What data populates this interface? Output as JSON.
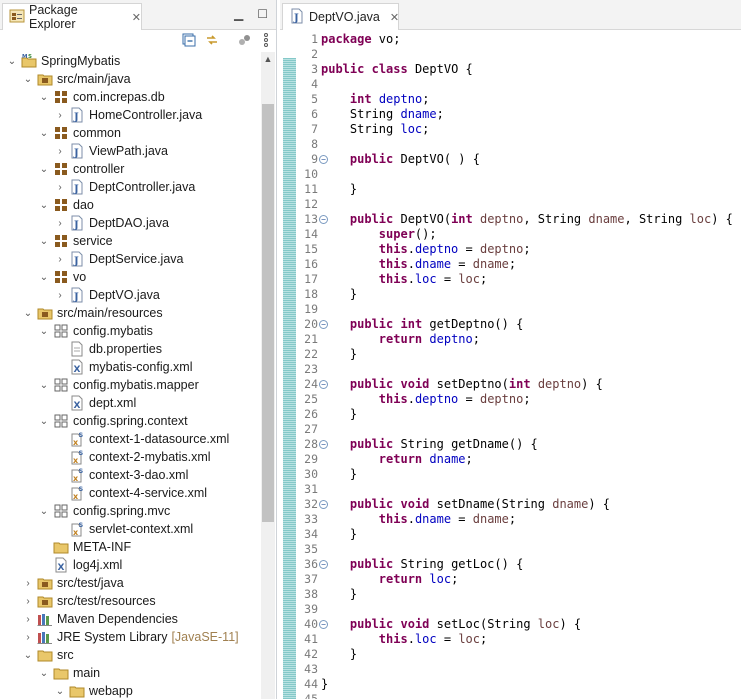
{
  "explorer": {
    "tab_title": "Package Explorer",
    "close_glyph": "✕",
    "minimize_glyph": "▁",
    "maximize_glyph": "☐",
    "toolbar": [
      {
        "name": "collapse-all-icon"
      },
      {
        "name": "link-with-editor-icon"
      },
      {
        "name": "focus-icon"
      },
      {
        "name": "view-menu-icon"
      }
    ],
    "tree": [
      {
        "depth": 0,
        "twisty": "open",
        "icon": "project",
        "label": "SpringMybatis"
      },
      {
        "depth": 1,
        "twisty": "open",
        "icon": "srcfolder",
        "label": "src/main/java"
      },
      {
        "depth": 2,
        "twisty": "open",
        "icon": "package",
        "label": "com.increpas.db"
      },
      {
        "depth": 3,
        "twisty": "closed",
        "icon": "javafile",
        "label": "HomeController.java"
      },
      {
        "depth": 2,
        "twisty": "open",
        "icon": "package",
        "label": "common"
      },
      {
        "depth": 3,
        "twisty": "closed",
        "icon": "javafile",
        "label": "ViewPath.java"
      },
      {
        "depth": 2,
        "twisty": "open",
        "icon": "package",
        "label": "controller"
      },
      {
        "depth": 3,
        "twisty": "closed",
        "icon": "javafile",
        "label": "DeptController.java"
      },
      {
        "depth": 2,
        "twisty": "open",
        "icon": "package",
        "label": "dao"
      },
      {
        "depth": 3,
        "twisty": "closed",
        "icon": "javafile",
        "label": "DeptDAO.java"
      },
      {
        "depth": 2,
        "twisty": "open",
        "icon": "package",
        "label": "service"
      },
      {
        "depth": 3,
        "twisty": "closed",
        "icon": "javafile",
        "label": "DeptService.java"
      },
      {
        "depth": 2,
        "twisty": "open",
        "icon": "package",
        "label": "vo"
      },
      {
        "depth": 3,
        "twisty": "closed",
        "icon": "javafile",
        "label": "DeptVO.java"
      },
      {
        "depth": 1,
        "twisty": "open",
        "icon": "srcfolder",
        "label": "src/main/resources"
      },
      {
        "depth": 2,
        "twisty": "open",
        "icon": "respackage",
        "label": "config.mybatis"
      },
      {
        "depth": 3,
        "twisty": "none",
        "icon": "file",
        "label": "db.properties"
      },
      {
        "depth": 3,
        "twisty": "none",
        "icon": "xmlfile",
        "label": "mybatis-config.xml"
      },
      {
        "depth": 2,
        "twisty": "open",
        "icon": "respackage",
        "label": "config.mybatis.mapper"
      },
      {
        "depth": 3,
        "twisty": "none",
        "icon": "xmlfile",
        "label": "dept.xml"
      },
      {
        "depth": 2,
        "twisty": "open",
        "icon": "respackage",
        "label": "config.spring.context"
      },
      {
        "depth": 3,
        "twisty": "none",
        "icon": "springxml",
        "label": "context-1-datasource.xml"
      },
      {
        "depth": 3,
        "twisty": "none",
        "icon": "springxml",
        "label": "context-2-mybatis.xml"
      },
      {
        "depth": 3,
        "twisty": "none",
        "icon": "springxml",
        "label": "context-3-dao.xml"
      },
      {
        "depth": 3,
        "twisty": "none",
        "icon": "springxml",
        "label": "context-4-service.xml"
      },
      {
        "depth": 2,
        "twisty": "open",
        "icon": "respackage",
        "label": "config.spring.mvc"
      },
      {
        "depth": 3,
        "twisty": "none",
        "icon": "springxml",
        "label": "servlet-context.xml"
      },
      {
        "depth": 2,
        "twisty": "none",
        "icon": "folder",
        "label": "META-INF"
      },
      {
        "depth": 2,
        "twisty": "none",
        "icon": "xmlfile",
        "label": "log4j.xml"
      },
      {
        "depth": 1,
        "twisty": "closed",
        "icon": "srcfolder",
        "label": "src/test/java"
      },
      {
        "depth": 1,
        "twisty": "closed",
        "icon": "srcfolder",
        "label": "src/test/resources"
      },
      {
        "depth": 1,
        "twisty": "closed",
        "icon": "library",
        "label": "Maven Dependencies"
      },
      {
        "depth": 1,
        "twisty": "closed",
        "icon": "library",
        "label": "JRE System Library",
        "deco": "[JavaSE-11]"
      },
      {
        "depth": 1,
        "twisty": "open",
        "icon": "folder",
        "label": "src"
      },
      {
        "depth": 2,
        "twisty": "open",
        "icon": "folder",
        "label": "main"
      },
      {
        "depth": 3,
        "twisty": "open",
        "icon": "folder",
        "label": "webapp"
      }
    ]
  },
  "editor": {
    "tab_title": "DeptVO.java",
    "close_glyph": "✕",
    "fold_glyph": "−",
    "lines": [
      {
        "n": "1",
        "t": [
          [
            "k",
            "package"
          ],
          [
            "p",
            " vo;"
          ]
        ]
      },
      {
        "n": "2",
        "t": []
      },
      {
        "n": "3",
        "t": [
          [
            "k",
            "public"
          ],
          [
            "p",
            " "
          ],
          [
            "k",
            "class"
          ],
          [
            "p",
            " DeptVO {"
          ]
        ]
      },
      {
        "n": "4",
        "t": []
      },
      {
        "n": "5",
        "t": [
          [
            "p",
            "    "
          ],
          [
            "k",
            "int"
          ],
          [
            "p",
            " "
          ],
          [
            "f",
            "deptno"
          ],
          [
            "p",
            ";"
          ]
        ]
      },
      {
        "n": "6",
        "t": [
          [
            "p",
            "    String "
          ],
          [
            "f",
            "dname"
          ],
          [
            "p",
            ";"
          ]
        ]
      },
      {
        "n": "7",
        "t": [
          [
            "p",
            "    String "
          ],
          [
            "f",
            "loc"
          ],
          [
            "p",
            ";"
          ]
        ]
      },
      {
        "n": "8",
        "t": []
      },
      {
        "n": "9",
        "fold": true,
        "t": [
          [
            "p",
            "    "
          ],
          [
            "k",
            "public"
          ],
          [
            "p",
            " DeptVO( ) {"
          ]
        ]
      },
      {
        "n": "10",
        "t": []
      },
      {
        "n": "11",
        "t": [
          [
            "p",
            "    }"
          ]
        ]
      },
      {
        "n": "12",
        "t": []
      },
      {
        "n": "13",
        "fold": true,
        "t": [
          [
            "p",
            "    "
          ],
          [
            "k",
            "public"
          ],
          [
            "p",
            " DeptVO("
          ],
          [
            "k",
            "int"
          ],
          [
            "p",
            " "
          ],
          [
            "m",
            "deptno"
          ],
          [
            "p",
            ", String "
          ],
          [
            "m",
            "dname"
          ],
          [
            "p",
            ", String "
          ],
          [
            "m",
            "loc"
          ],
          [
            "p",
            ") {"
          ]
        ]
      },
      {
        "n": "14",
        "t": [
          [
            "p",
            "        "
          ],
          [
            "k",
            "super"
          ],
          [
            "p",
            "();"
          ]
        ]
      },
      {
        "n": "15",
        "t": [
          [
            "p",
            "        "
          ],
          [
            "k",
            "this"
          ],
          [
            "p",
            "."
          ],
          [
            "f",
            "deptno"
          ],
          [
            "p",
            " = "
          ],
          [
            "m",
            "deptno"
          ],
          [
            "p",
            ";"
          ]
        ]
      },
      {
        "n": "16",
        "t": [
          [
            "p",
            "        "
          ],
          [
            "k",
            "this"
          ],
          [
            "p",
            "."
          ],
          [
            "f",
            "dname"
          ],
          [
            "p",
            " = "
          ],
          [
            "m",
            "dname"
          ],
          [
            "p",
            ";"
          ]
        ]
      },
      {
        "n": "17",
        "t": [
          [
            "p",
            "        "
          ],
          [
            "k",
            "this"
          ],
          [
            "p",
            "."
          ],
          [
            "f",
            "loc"
          ],
          [
            "p",
            " = "
          ],
          [
            "m",
            "loc"
          ],
          [
            "p",
            ";"
          ]
        ]
      },
      {
        "n": "18",
        "t": [
          [
            "p",
            "    }"
          ]
        ]
      },
      {
        "n": "19",
        "t": []
      },
      {
        "n": "20",
        "fold": true,
        "t": [
          [
            "p",
            "    "
          ],
          [
            "k",
            "public"
          ],
          [
            "p",
            " "
          ],
          [
            "k",
            "int"
          ],
          [
            "p",
            " getDeptno() {"
          ]
        ]
      },
      {
        "n": "21",
        "t": [
          [
            "p",
            "        "
          ],
          [
            "k",
            "return"
          ],
          [
            "p",
            " "
          ],
          [
            "f",
            "deptno"
          ],
          [
            "p",
            ";"
          ]
        ]
      },
      {
        "n": "22",
        "t": [
          [
            "p",
            "    }"
          ]
        ]
      },
      {
        "n": "23",
        "t": []
      },
      {
        "n": "24",
        "fold": true,
        "t": [
          [
            "p",
            "    "
          ],
          [
            "k",
            "public"
          ],
          [
            "p",
            " "
          ],
          [
            "k",
            "void"
          ],
          [
            "p",
            " setDeptno("
          ],
          [
            "k",
            "int"
          ],
          [
            "p",
            " "
          ],
          [
            "m",
            "deptno"
          ],
          [
            "p",
            ") {"
          ]
        ]
      },
      {
        "n": "25",
        "t": [
          [
            "p",
            "        "
          ],
          [
            "k",
            "this"
          ],
          [
            "p",
            "."
          ],
          [
            "f",
            "deptno"
          ],
          [
            "p",
            " = "
          ],
          [
            "m",
            "deptno"
          ],
          [
            "p",
            ";"
          ]
        ]
      },
      {
        "n": "26",
        "t": [
          [
            "p",
            "    }"
          ]
        ]
      },
      {
        "n": "27",
        "t": []
      },
      {
        "n": "28",
        "fold": true,
        "t": [
          [
            "p",
            "    "
          ],
          [
            "k",
            "public"
          ],
          [
            "p",
            " String getDname() {"
          ]
        ]
      },
      {
        "n": "29",
        "t": [
          [
            "p",
            "        "
          ],
          [
            "k",
            "return"
          ],
          [
            "p",
            " "
          ],
          [
            "f",
            "dname"
          ],
          [
            "p",
            ";"
          ]
        ]
      },
      {
        "n": "30",
        "t": [
          [
            "p",
            "    }"
          ]
        ]
      },
      {
        "n": "31",
        "t": []
      },
      {
        "n": "32",
        "fold": true,
        "t": [
          [
            "p",
            "    "
          ],
          [
            "k",
            "public"
          ],
          [
            "p",
            " "
          ],
          [
            "k",
            "void"
          ],
          [
            "p",
            " setDname(String "
          ],
          [
            "m",
            "dname"
          ],
          [
            "p",
            ") {"
          ]
        ]
      },
      {
        "n": "33",
        "t": [
          [
            "p",
            "        "
          ],
          [
            "k",
            "this"
          ],
          [
            "p",
            "."
          ],
          [
            "f",
            "dname"
          ],
          [
            "p",
            " = "
          ],
          [
            "m",
            "dname"
          ],
          [
            "p",
            ";"
          ]
        ]
      },
      {
        "n": "34",
        "t": [
          [
            "p",
            "    }"
          ]
        ]
      },
      {
        "n": "35",
        "t": []
      },
      {
        "n": "36",
        "fold": true,
        "t": [
          [
            "p",
            "    "
          ],
          [
            "k",
            "public"
          ],
          [
            "p",
            " String getLoc() {"
          ]
        ]
      },
      {
        "n": "37",
        "t": [
          [
            "p",
            "        "
          ],
          [
            "k",
            "return"
          ],
          [
            "p",
            " "
          ],
          [
            "f",
            "loc"
          ],
          [
            "p",
            ";"
          ]
        ]
      },
      {
        "n": "38",
        "t": [
          [
            "p",
            "    }"
          ]
        ]
      },
      {
        "n": "39",
        "t": []
      },
      {
        "n": "40",
        "fold": true,
        "t": [
          [
            "p",
            "    "
          ],
          [
            "k",
            "public"
          ],
          [
            "p",
            " "
          ],
          [
            "k",
            "void"
          ],
          [
            "p",
            " setLoc(String "
          ],
          [
            "m",
            "loc"
          ],
          [
            "p",
            ") {"
          ]
        ]
      },
      {
        "n": "41",
        "t": [
          [
            "p",
            "        "
          ],
          [
            "k",
            "this"
          ],
          [
            "p",
            "."
          ],
          [
            "f",
            "loc"
          ],
          [
            "p",
            " = "
          ],
          [
            "m",
            "loc"
          ],
          [
            "p",
            ";"
          ]
        ]
      },
      {
        "n": "42",
        "t": [
          [
            "p",
            "    }"
          ]
        ]
      },
      {
        "n": "43",
        "t": []
      },
      {
        "n": "44",
        "t": [
          [
            "p",
            "}"
          ]
        ]
      },
      {
        "n": "45",
        "t": []
      }
    ]
  }
}
